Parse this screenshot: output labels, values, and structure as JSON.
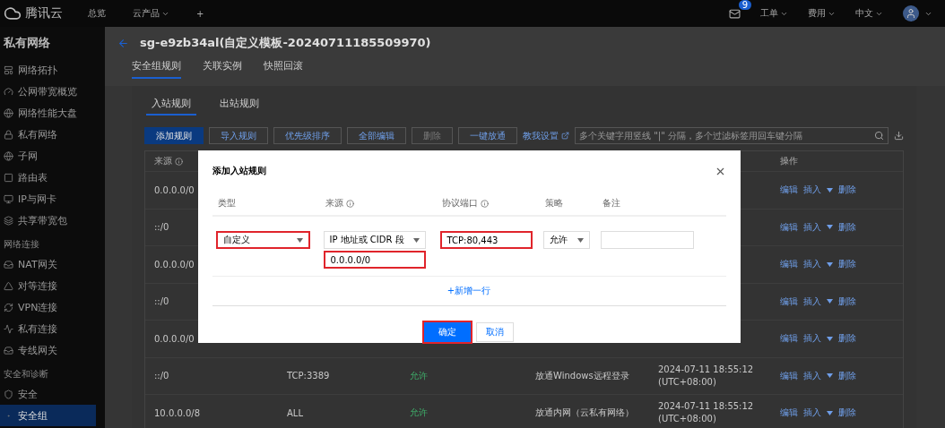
{
  "topbar": {
    "brand": "腾讯云",
    "nav": [
      {
        "label": "总览",
        "dropdown": false
      },
      {
        "label": "云产品",
        "dropdown": true
      }
    ],
    "add": "+",
    "mail_badge": "9",
    "menus": [
      "工单",
      "费用",
      "中文"
    ]
  },
  "sidebar": {
    "title": "私有网络",
    "items": [
      {
        "kind": "item",
        "label": "网络拓扑",
        "selected": false
      },
      {
        "kind": "item",
        "label": "公网带宽概览",
        "selected": false
      },
      {
        "kind": "item",
        "label": "网络性能大盘",
        "selected": false
      },
      {
        "kind": "item",
        "label": "私有网络",
        "selected": false
      },
      {
        "kind": "item",
        "label": "子网",
        "selected": false
      },
      {
        "kind": "item",
        "label": "路由表",
        "selected": false
      },
      {
        "kind": "item",
        "label": "IP与网卡",
        "selected": false
      },
      {
        "kind": "item",
        "label": "共享带宽包",
        "selected": false
      },
      {
        "kind": "section",
        "label": "网络连接"
      },
      {
        "kind": "item",
        "label": "NAT网关",
        "selected": false
      },
      {
        "kind": "item",
        "label": "对等连接",
        "selected": false
      },
      {
        "kind": "item",
        "label": "VPN连接",
        "selected": false
      },
      {
        "kind": "item",
        "label": "私有连接",
        "selected": false
      },
      {
        "kind": "item",
        "label": "专线网关",
        "selected": false
      },
      {
        "kind": "section",
        "label": "安全和诊断"
      },
      {
        "kind": "item",
        "label": "安全",
        "selected": false
      },
      {
        "kind": "item",
        "label": "安全组",
        "selected": true
      }
    ]
  },
  "header": {
    "title": "sg-e9zb34al(自定义模板-20240711185509970)",
    "tabs": [
      {
        "label": "安全组规则",
        "selected": true
      },
      {
        "label": "关联实例",
        "selected": false
      },
      {
        "label": "快照回滚",
        "selected": false
      }
    ]
  },
  "subtabs": [
    {
      "label": "入站规则",
      "selected": true
    },
    {
      "label": "出站规则",
      "selected": false
    }
  ],
  "toolbar": {
    "buttons": [
      {
        "label": "添加规则",
        "primary": true,
        "disabled": false
      },
      {
        "label": "导入规则",
        "primary": false,
        "disabled": false
      },
      {
        "label": "优先级排序",
        "primary": false,
        "disabled": false
      },
      {
        "label": "全部编辑",
        "primary": false,
        "disabled": false
      },
      {
        "label": "删除",
        "primary": false,
        "disabled": true
      },
      {
        "label": "一键放通",
        "primary": false,
        "disabled": false
      }
    ],
    "help_link": "教我设置",
    "search": {
      "placeholder": "多个关键字用竖线 \"|\" 分隔，多个过滤标签用回车键分隔"
    }
  },
  "table": {
    "columns": {
      "source": "来源",
      "actions": "操作"
    },
    "rows": [
      {
        "source": "0.0.0.0/0",
        "actions": [
          "编辑",
          "插入",
          "删除"
        ]
      },
      {
        "source": "::/0",
        "actions": [
          "编辑",
          "插入",
          "删除"
        ]
      },
      {
        "source": "0.0.0.0/0",
        "actions": [
          "编辑",
          "插入",
          "删除"
        ]
      },
      {
        "source": "::/0",
        "actions": [
          "编辑",
          "插入",
          "删除"
        ]
      },
      {
        "source": "0.0.0.0/0",
        "actions": [
          "编辑",
          "插入",
          "删除"
        ]
      },
      {
        "source": "::/0",
        "port": "TCP:3389",
        "policy": "允许",
        "note": "放通Windows远程登录",
        "time": [
          "2024-07-11 18:55:12",
          "(UTC+08:00)"
        ],
        "actions": [
          "编辑",
          "插入",
          "删除"
        ]
      },
      {
        "source": "10.0.0.0/8",
        "port": "ALL",
        "policy": "允许",
        "note": "放通内网（云私有网络）",
        "time": [
          "2024-07-11 18:55:12",
          "(UTC+08:00)"
        ],
        "actions": [
          "编辑",
          "插入",
          "删除"
        ]
      }
    ]
  },
  "modal": {
    "title": "添加入站规则",
    "columns": [
      {
        "label": "类型",
        "info": false
      },
      {
        "label": "来源",
        "info": true
      },
      {
        "label": "协议端口",
        "info": true
      },
      {
        "label": "策略",
        "info": false
      },
      {
        "label": "备注",
        "info": false
      }
    ],
    "cells": [
      [
        {
          "kind": "select",
          "value": "自定义",
          "highlighted": true
        }
      ],
      [
        {
          "kind": "select",
          "value": "IP 地址或 CIDR 段",
          "highlighted": false
        },
        {
          "kind": "input",
          "value": "0.0.0.0/0",
          "highlighted": true
        }
      ],
      [
        {
          "kind": "input",
          "value": "TCP:80,443",
          "highlighted": true
        }
      ],
      [
        {
          "kind": "select",
          "value": "允许",
          "highlighted": false
        }
      ],
      [
        {
          "kind": "input",
          "highlighted": false
        }
      ]
    ],
    "add_row": "+新增一行",
    "buttons": [
      {
        "label": "确定",
        "primary": true,
        "highlighted": true
      },
      {
        "label": "取消",
        "primary": false,
        "highlighted": false
      }
    ]
  }
}
